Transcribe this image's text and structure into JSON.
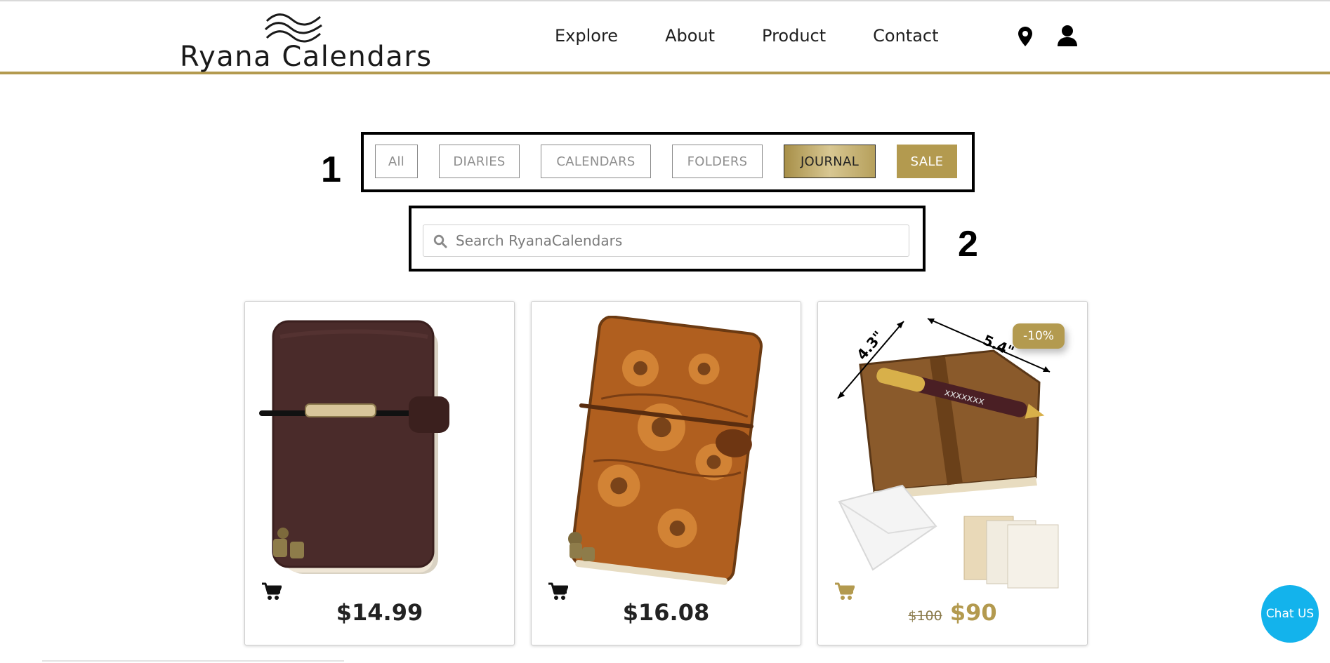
{
  "brand": {
    "name": "Ryana Calendars"
  },
  "nav": {
    "items": [
      {
        "label": "Explore"
      },
      {
        "label": "About"
      },
      {
        "label": "Product"
      },
      {
        "label": "Contact"
      }
    ],
    "icons": [
      "location-pin-icon",
      "user-icon"
    ]
  },
  "annotations": {
    "filters_number": "1",
    "search_number": "2"
  },
  "filters": [
    {
      "label": "All"
    },
    {
      "label": "DIARIES"
    },
    {
      "label": "CALENDARS"
    },
    {
      "label": "FOLDERS"
    },
    {
      "label": "JOURNAL",
      "state": "active"
    },
    {
      "label": "SALE",
      "state": "highlighted"
    }
  ],
  "search": {
    "placeholder": "Search RyanaCalendars",
    "value": "",
    "icon": "search-icon"
  },
  "products": [
    {
      "image": "dark brown leather journal with metal bar and elastic strap",
      "price": "$14.99",
      "cart_icon": "cart-icon"
    },
    {
      "image": "tan floral embossed leather journal",
      "price": "$16.08",
      "cart_icon": "cart-icon"
    },
    {
      "image": "brown leather journal with pen, dimensions and paper inserts",
      "dimensions": [
        "4.3\"",
        "5.4\""
      ],
      "badge": "-10%",
      "old_price": "$100",
      "price": "$90",
      "cart_icon": "cart-icon"
    }
  ],
  "chat": {
    "label": "Chat US"
  },
  "colors": {
    "accent": "#b39a4f",
    "chat": "#13b3ec",
    "text": "#222222"
  }
}
